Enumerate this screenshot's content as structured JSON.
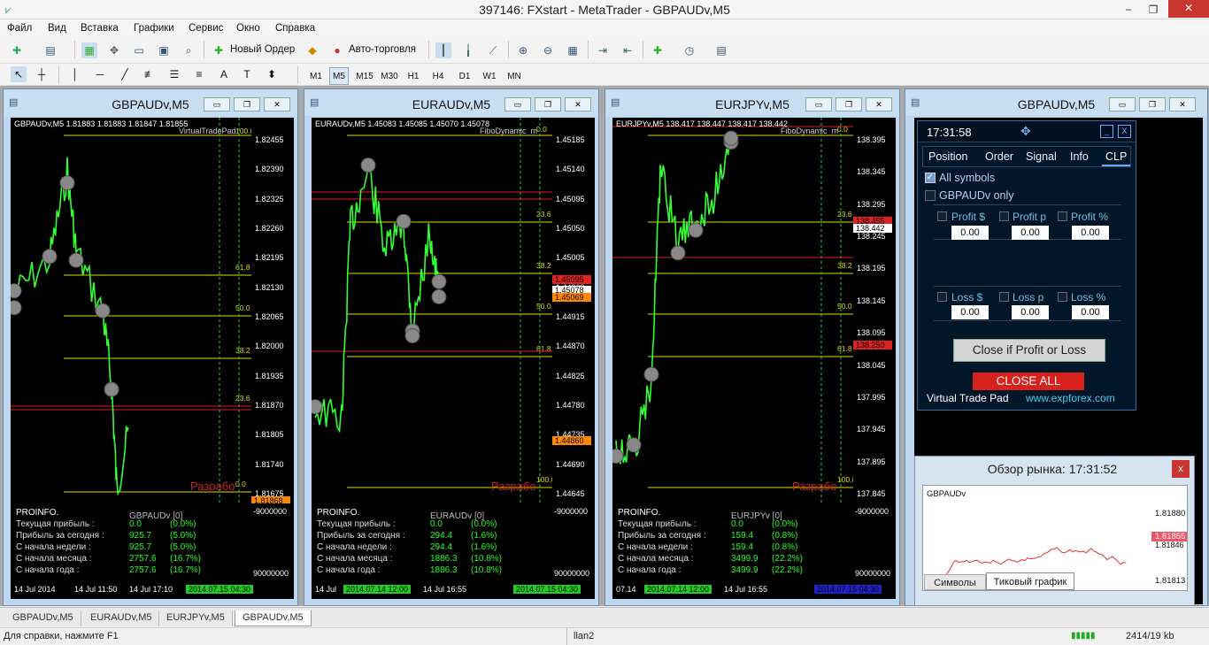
{
  "window": {
    "title": "397146: FXstart - MetaTrader - GBPAUDv,M5",
    "minimize": "−",
    "restore": "❐",
    "close": "✕"
  },
  "menu": [
    "Файл",
    "Вид",
    "Вставка",
    "Графики",
    "Сервис",
    "Окно",
    "Справка"
  ],
  "toolbar": {
    "new_order": "Новый Ордер",
    "auto_trading": "Авто-торговля"
  },
  "timeframes": [
    "M1",
    "M5",
    "M15",
    "M30",
    "H1",
    "H4",
    "D1",
    "W1",
    "MN"
  ],
  "active_timeframe": "M5",
  "charts": [
    {
      "title": "GBPAUDv,M5",
      "header": "GBPAUDv,M5  1.81883 1.81883 1.81847 1.81855",
      "indicator": "VirtualTradePad",
      "prices": [
        "1.82455",
        "1.82390",
        "1.82325",
        "1.82260",
        "1.82195",
        "1.82130",
        "1.82065",
        "1.82000",
        "1.81935",
        "1.81870",
        "1.81805",
        "1.81740",
        "1.81675"
      ],
      "fib": [
        "100.0",
        "61.8",
        "50.0",
        "38.2",
        "23.6",
        "0.0"
      ],
      "markers": [
        "1.81868"
      ],
      "watermark": "Разрабо",
      "xaxis": [
        "14 Jul 2014",
        "14 Jul 11:50",
        "14 Jul 17:10",
        "2014.07.15 04:30"
      ],
      "yfooter": [
        "-9000000",
        "90000000"
      ],
      "proinfo": {
        "title": "PROINFO.",
        "symbol": "GBPAUDv [0]",
        "rows": [
          [
            "Текущая прибыль :",
            "0.0",
            "(0.0%)"
          ],
          [
            "Прибыль за сегодня :",
            "925.7",
            "(5.0%)"
          ],
          [
            "С начала недели :",
            "925.7",
            "(5.0%)"
          ],
          [
            "С начала месяца :",
            "2757.6",
            "(16.7%)"
          ],
          [
            "С начала года :",
            "2757.6",
            "(16.7%)"
          ]
        ]
      }
    },
    {
      "title": "EURAUDv,M5",
      "header": "EURAUDv,M5  1.45083 1.45085 1.45070 1.45078",
      "indicator": "FiboDynamic_m",
      "prices": [
        "1.45185",
        "1.45140",
        "1.45095",
        "1.45050",
        "1.45005",
        "1.44960",
        "1.44915",
        "1.44870",
        "1.44825",
        "1.44780",
        "1.44735",
        "1.44690",
        "1.44645"
      ],
      "fib": [
        "0.0",
        "23.6",
        "38.2",
        "50.0",
        "61.8",
        "100.0"
      ],
      "markers": [
        "1.45095",
        "1.45078",
        "1.45069",
        "1.44860"
      ],
      "watermark": "Разрабо",
      "xaxis": [
        "14 Jul",
        "2014.07.14 12:00",
        "14 Jul 16:55",
        "2014.07.15 04:30"
      ],
      "yfooter": [
        "-9000000",
        "90000000"
      ],
      "proinfo": {
        "title": "PROINFO.",
        "symbol": "EURAUDv [0]",
        "rows": [
          [
            "Текущая прибыль :",
            "0.0",
            "(0.0%)"
          ],
          [
            "Прибыль за сегодня :",
            "294.4",
            "(1.6%)"
          ],
          [
            "С начала недели :",
            "294.4",
            "(1.6%)"
          ],
          [
            "С начала месяца :",
            "1886.3",
            "(10.8%)"
          ],
          [
            "С начала года :",
            "1886.3",
            "(10.8%)"
          ]
        ]
      }
    },
    {
      "title": "EURJPYv,M5",
      "header": "EURJPYv,M5  138.417 138.447 138.417 138.442",
      "indicator": "FiboDynamic_m",
      "prices": [
        "138.395",
        "138.345",
        "138.295",
        "138.245",
        "138.195",
        "138.145",
        "138.095",
        "138.045",
        "137.995",
        "137.945",
        "137.895",
        "137.845"
      ],
      "fib": [
        "0.0",
        "23.6",
        "38.2",
        "50.0",
        "61.8",
        "100.0"
      ],
      "markers": [
        "138.455",
        "138.442",
        "138.250"
      ],
      "watermark": "Разрабо",
      "xaxis": [
        "07.14",
        "2014.07.14 12:00",
        "14 Jul 16:55",
        "2014.07.15 04:30"
      ],
      "yfooter": [
        "-9000000",
        "90000000"
      ],
      "proinfo": {
        "title": "PROINFO.",
        "symbol": "EURJPYv [0]",
        "rows": [
          [
            "Текущая прибыль :",
            "0.0",
            "(0.0%)"
          ],
          [
            "Прибыль за сегодня :",
            "159.4",
            "(0.8%)"
          ],
          [
            "С начала недели :",
            "159.4",
            "(0.8%)"
          ],
          [
            "С начала месяца :",
            "3499.9",
            "(22.2%)"
          ],
          [
            "С начала года :",
            "3499.9",
            "(22.2%)"
          ]
        ]
      }
    }
  ],
  "right_chart": {
    "title": "GBPAUDv,M5"
  },
  "vtp": {
    "time": "17:31:58",
    "tabs": [
      "Position",
      "Order",
      "Signal",
      "Info",
      "CLP"
    ],
    "all_symbols": "All symbols",
    "symbol_only": "GBPAUDv only",
    "profit_labels": [
      "Profit $",
      "Profit p",
      "Profit %"
    ],
    "profit_values": [
      "0.00",
      "0.00",
      "0.00"
    ],
    "loss_labels": [
      "Loss $",
      "Loss p",
      "Loss %"
    ],
    "loss_values": [
      "0.00",
      "0.00",
      "0.00"
    ],
    "close_if": "Close if Profit or Loss",
    "close_all": "CLOSE ALL",
    "footer_name": "Virtual Trade Pad",
    "footer_url": "www.expforex.com"
  },
  "market": {
    "title": "Обзор рынка: 17:31:52",
    "symbol": "GBPAUDv",
    "prices": [
      "1.81880",
      "1.81855",
      "1.81846",
      "1.81813"
    ],
    "tabs": [
      "Символы",
      "Тиковый график"
    ]
  },
  "chart_tabs": [
    "GBPAUDv,M5",
    "EURAUDv,M5",
    "EURJPYv,M5",
    "GBPAUDv,M5"
  ],
  "status": {
    "help": "Для справки, нажмите F1",
    "profile": "llan2",
    "traffic": "2414/19 kb"
  }
}
